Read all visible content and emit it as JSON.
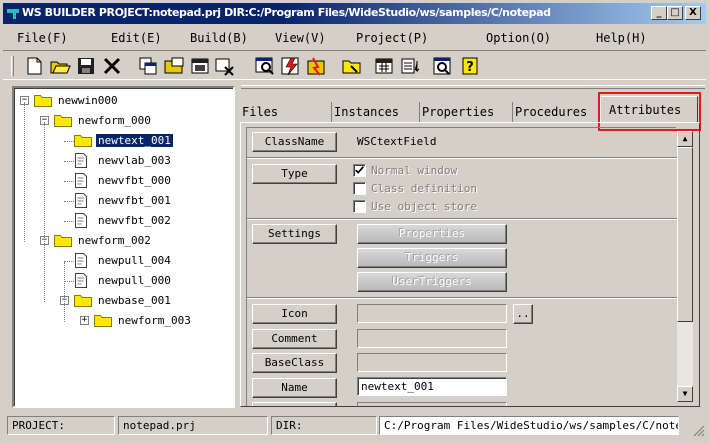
{
  "window": {
    "title": "WS BUILDER PROJECT:notepad.prj DIR:C:/Program Files/WideStudio/ws/samples/C/notepad",
    "minimize_glyph": "_",
    "maximize_glyph": "□",
    "close_glyph": "X"
  },
  "menu": [
    "File(F)",
    "Edit(E)",
    "Build(B)",
    "View(V)",
    "Project(P)",
    "Option(O)",
    "Help(H)"
  ],
  "toolbar": {
    "icons": [
      "new-file-icon",
      "open-folder-icon",
      "save-icon",
      "delete-icon",
      "copy-icon",
      "open-window-icon",
      "window-icon",
      "close-window-icon",
      "search-icon",
      "build-icon",
      "run-icon",
      "folder-open-icon",
      "calendar-icon",
      "list-icon",
      "preview-icon",
      "help-icon"
    ]
  },
  "tree": {
    "nodes": [
      {
        "label": "newwin000",
        "type": "folder",
        "level": 0,
        "expander": "−"
      },
      {
        "label": "newform_000",
        "type": "folder",
        "level": 1,
        "expander": "−"
      },
      {
        "label": "newtext_001",
        "type": "folder",
        "level": 2,
        "selected": true
      },
      {
        "label": "newvlab_003",
        "type": "doc",
        "level": 2
      },
      {
        "label": "newvfbt_000",
        "type": "doc",
        "level": 2
      },
      {
        "label": "newvfbt_001",
        "type": "doc",
        "level": 2
      },
      {
        "label": "newvfbt_002",
        "type": "doc",
        "level": 2
      },
      {
        "label": "newform_002",
        "type": "folder",
        "level": 1,
        "expander": "−"
      },
      {
        "label": "newpull_004",
        "type": "doc",
        "level": 2
      },
      {
        "label": "newpull_000",
        "type": "doc",
        "level": 2
      },
      {
        "label": "newbase_001",
        "type": "folder",
        "level": 2,
        "expander": "−"
      },
      {
        "label": "newform_003",
        "type": "folder",
        "level": 3,
        "expander": "+"
      }
    ]
  },
  "tabs": {
    "files": "Files",
    "instances": "Instances",
    "properties": "Properties",
    "procedures": "Procedures",
    "attributes": "Attributes",
    "active": "attributes"
  },
  "attributes": {
    "classname_label": "ClassName",
    "classname_value": "WSCtextField",
    "type_label": "Type",
    "type_options": [
      {
        "label": "Normal window",
        "checked": true
      },
      {
        "label": "Class definition",
        "checked": false
      },
      {
        "label": "Use object store",
        "checked": false
      }
    ],
    "settings_label": "Settings",
    "settings_buttons": [
      "Properties",
      "Triggers",
      "UserTriggers"
    ],
    "icon_label": "Icon",
    "icon_browse": "..",
    "comment_label": "Comment",
    "baseclass_label": "BaseClass",
    "name_label": "Name",
    "name_value": "newtext_001",
    "partial_label": "T"
  },
  "status": {
    "project_label": "PROJECT:",
    "project_value": "notepad.prj",
    "dir_label": "DIR:",
    "dir_value": "C:/Program Files/WideStudio/ws/samples/C/note"
  },
  "colors": {
    "title_bar": "#0a246a",
    "selection": "#0a246a",
    "highlight_box": "#e81818",
    "folder": "#ffe800"
  }
}
